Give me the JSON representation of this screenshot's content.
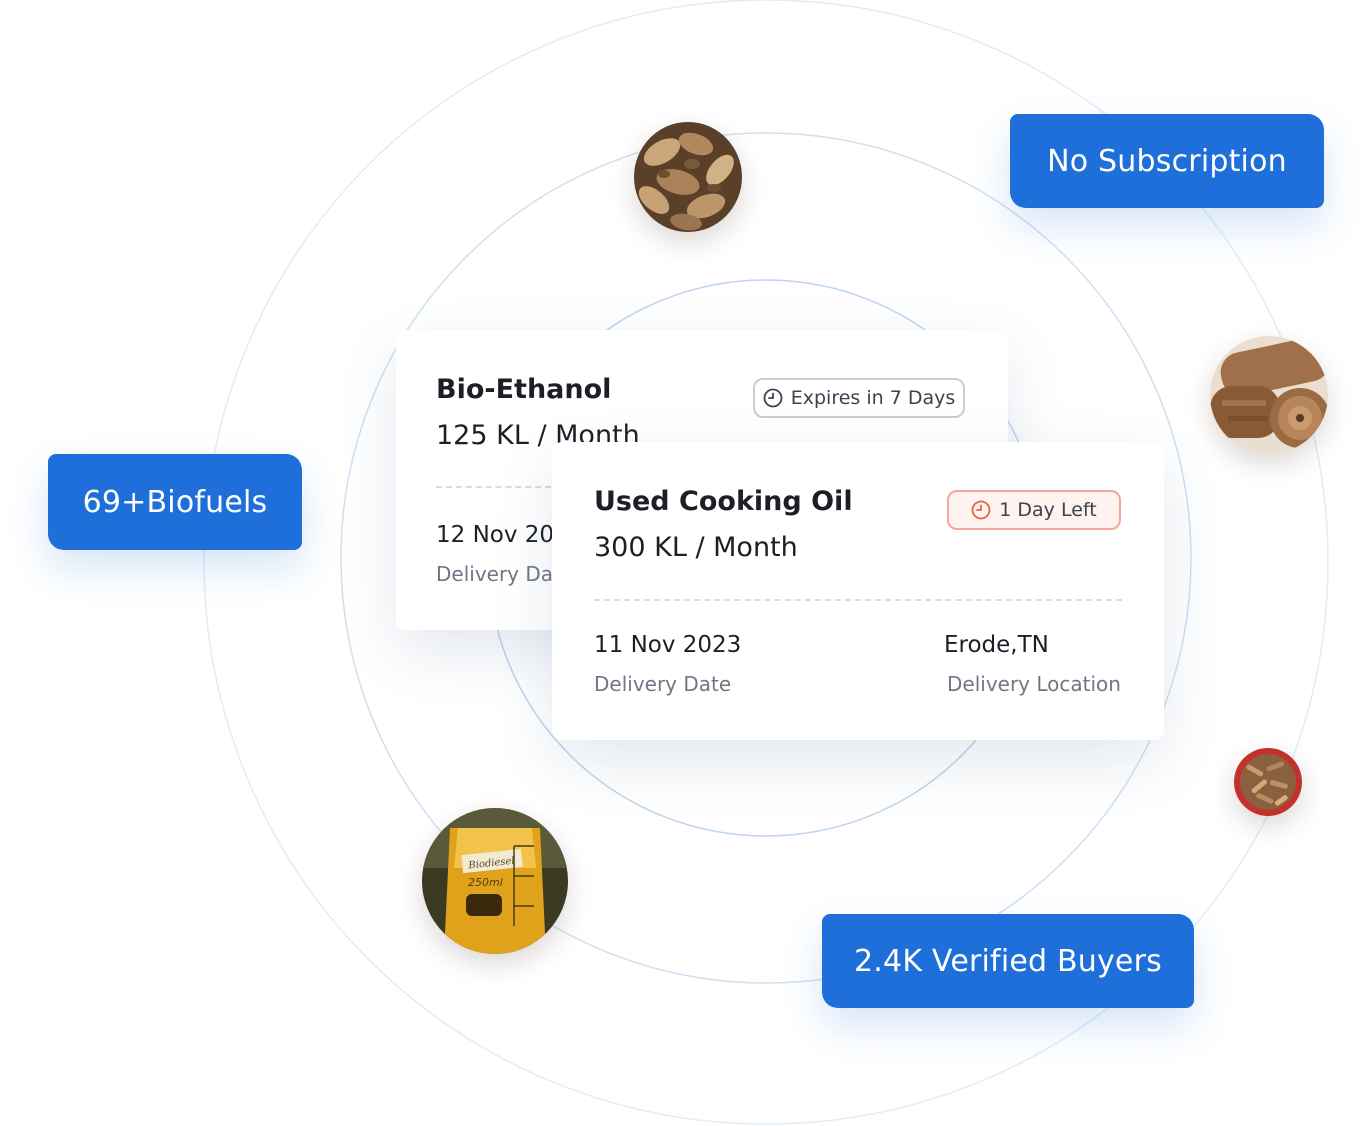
{
  "highlights": {
    "no_subscription": "No Subscription",
    "biofuels_count": "69+Biofuels",
    "verified_buyers": "2.4K Verified Buyers"
  },
  "listings": [
    {
      "title": "Bio-Ethanol",
      "quantity": "125 KL / Month",
      "badge": "Expires in 7 Days",
      "delivery_date": "12 Nov 20",
      "delivery_date_label": "Delivery Dat"
    },
    {
      "title": "Used Cooking Oil",
      "quantity": "300 KL / Month",
      "badge": "1 Day Left",
      "delivery_date": "11 Nov 2023",
      "delivery_date_label": "Delivery Date",
      "delivery_location": "Erode,TN",
      "delivery_location_label": "Delivery Location"
    }
  ],
  "beaker": {
    "label": "Biodiesel",
    "volume": "250ml"
  },
  "colors": {
    "accent": "#1e6fd9",
    "alert_border": "#f4a895",
    "alert_icon": "#e0654a",
    "ring": "#cfe0f2"
  },
  "icons": {
    "badge_icon": "clock-icon"
  }
}
